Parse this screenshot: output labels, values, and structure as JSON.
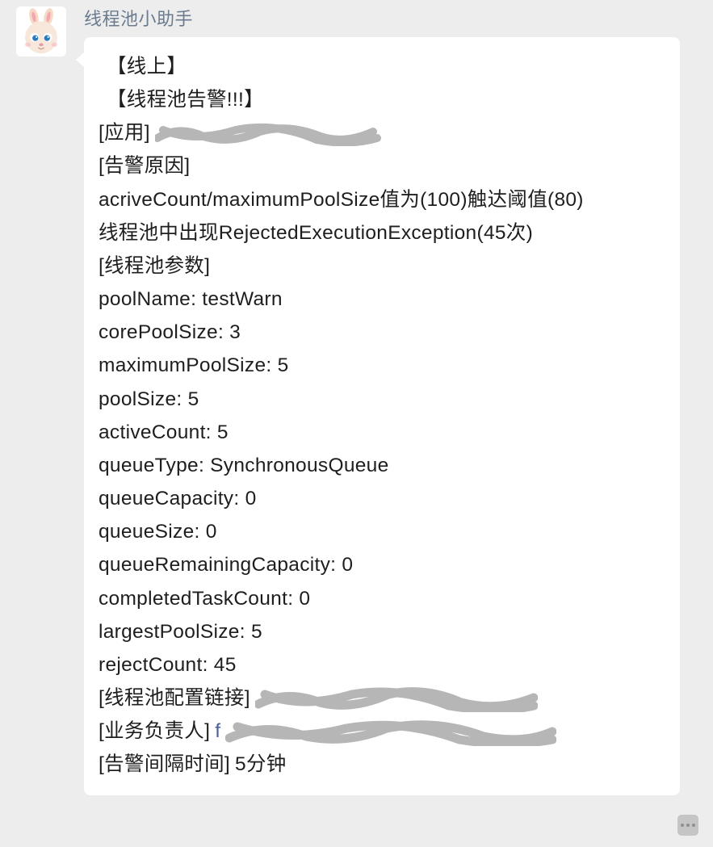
{
  "sender": "线程池小助手",
  "avatar_alt": "rabbit-avatar",
  "msg": {
    "head1": "【线上】",
    "head2": "【线程池告警!!!】",
    "app_label": "[应用]",
    "reason_label": "[告警原因]",
    "reason_line1": "acriveCount/maximumPoolSize值为(100)触达阈值(80)",
    "reason_line2": "线程池中出现RejectedExecutionException(45次)",
    "params_label": "[线程池参数]",
    "params": {
      "poolName": "poolName: testWarn",
      "corePoolSize": "corePoolSize: 3",
      "maximumPoolSize": "maximumPoolSize: 5",
      "poolSize": "poolSize: 5",
      "activeCount": "activeCount: 5",
      "queueType": "queueType: SynchronousQueue",
      "queueCapacity": "queueCapacity: 0",
      "queueSize": "queueSize: 0",
      "queueRemainingCapacity": "queueRemainingCapacity: 0",
      "completedTaskCount": "completedTaskCount: 0",
      "largestPoolSize": "largestPoolSize: 5",
      "rejectCount": "rejectCount: 45"
    },
    "link_label": "[线程池配置链接]",
    "owner_label": "[业务负责人]",
    "owner_link_prefix": "f",
    "interval_label": "[告警间隔时间]",
    "interval_value": "5分钟"
  }
}
